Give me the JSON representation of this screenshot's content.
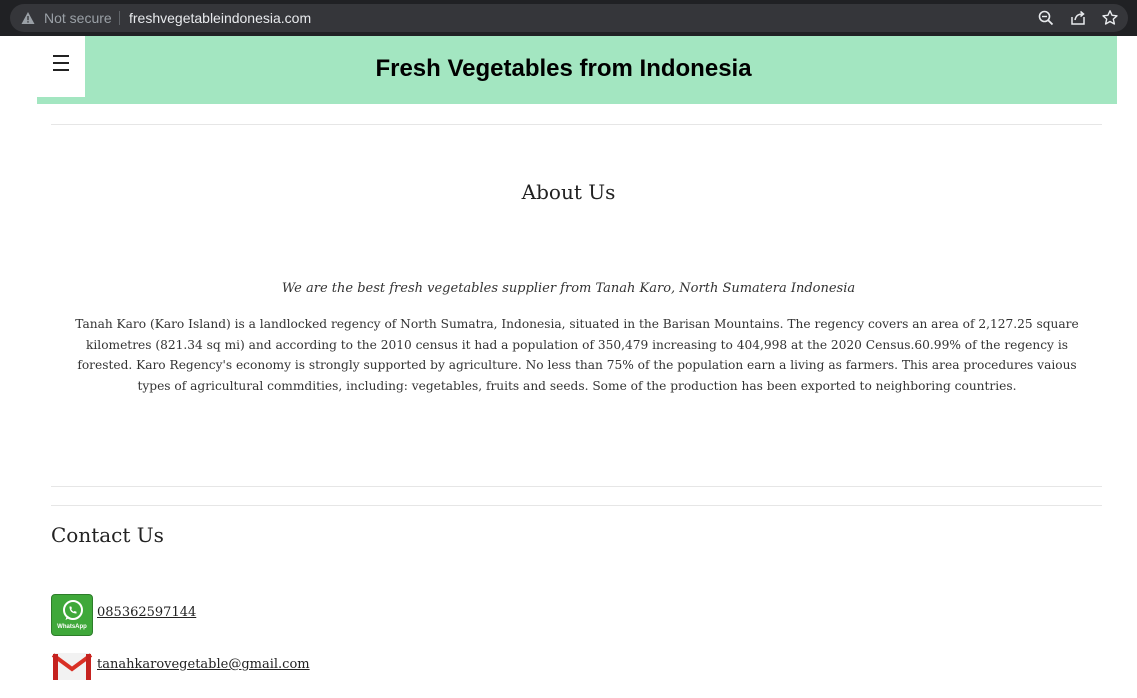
{
  "browser": {
    "security_label": "Not secure",
    "url": "freshvegetableindonesia.com",
    "icons": [
      "warning-icon",
      "zoom-icon",
      "share-icon",
      "bookmark-star-icon"
    ]
  },
  "header": {
    "title": "Fresh Vegetables from Indonesia",
    "menu_icon": "hamburger-menu-icon",
    "background": "#a3e6c1"
  },
  "about": {
    "heading": "About Us",
    "tagline": "We are the best fresh vegetables supplier from Tanah Karo, North Sumatera Indonesia",
    "body": "Tanah Karo (Karo Island) is a landlocked regency of North Sumatra, Indonesia, situated in the Barisan Mountains. The regency covers an area of 2,127.25 square kilometres (821.34 sq mi) and according to the 2010 census it had a population of 350,479 increasing to 404,998 at the 2020 Census.60.99% of the regency is forested. Karo Regency's economy is strongly supported by agriculture. No less than 75% of the population earn a living as farmers. This area procedures vaious types of agricultural commdities, including: vegetables, fruits and seeds. Some of the production has been exported to neighboring countries."
  },
  "contact": {
    "heading": "Contact Us",
    "whatsapp": {
      "icon": "whatsapp-icon",
      "icon_label": "WhatsApp",
      "number": "085362597144"
    },
    "email": {
      "icon": "gmail-icon",
      "address": "tanahkarovegetable@gmail.com"
    }
  }
}
